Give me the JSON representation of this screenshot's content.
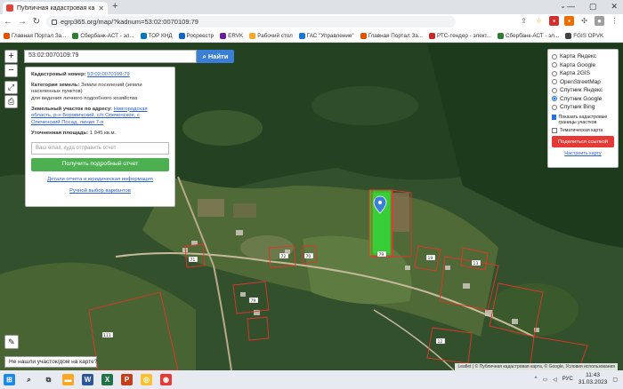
{
  "browser": {
    "tab_title": "Публичная кадастровая карта",
    "url": "egrp365.org/map/?kadnum=53:02:0070109:79",
    "bookmarks": [
      "Главная Портал За...",
      "Сбербанк-АСТ - эл...",
      "ТОР КНД",
      "Росреестр",
      "ERVK",
      "Рабочий стол",
      "ГАС \"Управление\"",
      "Главная Портал За...",
      "РТС-тендер - элект...",
      "Сбербанк-АСТ - эл...",
      "FGIS OPVK"
    ]
  },
  "search": {
    "value": "53:02:0070109:79",
    "button": "Найти"
  },
  "panel": {
    "cadnum_label": "Кадастровый номер:",
    "cadnum": "53:02:0070109:79",
    "category_label": "Категория земель:",
    "category": "Земли поселений (земли населенных пунктов)",
    "use": "для ведения личного подсобного хозяйства",
    "address_label": "Земельный участок по адресу:",
    "address": "Новгородская область, р-н Боровичский, с/п Опеченское, с Опеченский Посад, линия 7-я",
    "area_label": "Уточненная площадь:",
    "area": "1 945 кв.м.",
    "email_placeholder": "Ваш email, куда отправить отчет",
    "get_report": "Получить подробный отчет",
    "details_link": "Детали отчета и юридическая информация",
    "manual_link": "Ручной выбор вариантов"
  },
  "layers": {
    "options": [
      {
        "label": "Карта Яндекс",
        "selected": false
      },
      {
        "label": "Карта Google",
        "selected": false
      },
      {
        "label": "Карта 2GIS",
        "selected": false
      },
      {
        "label": "OpenStreetMap",
        "selected": false
      },
      {
        "label": "Спутник Яндекс",
        "selected": false
      },
      {
        "label": "Спутник Google",
        "selected": true
      },
      {
        "label": "Спутник Bing",
        "selected": false
      }
    ],
    "show_borders": "Показать кадастровые границы участков",
    "thematic": "Тематическая карта",
    "share": "Поделиться ссылкой",
    "configure": "Настроить карту"
  },
  "map": {
    "plot_labels": [
      "79",
      "71",
      "72",
      "70",
      "19",
      "79",
      "111",
      "12",
      "13"
    ],
    "not_found": "Не нашли участок/дом на карте?",
    "attribution": "Leaflet | © Публичная кадастровая карта, © Google, Условия использования"
  },
  "taskbar": {
    "lang": "РУС",
    "time": "11:43",
    "date": "31.03.2023"
  }
}
